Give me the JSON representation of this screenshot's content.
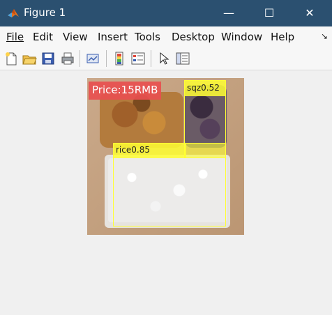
{
  "window": {
    "title": "Figure 1",
    "controls": {
      "minimize": "—",
      "maximize": "☐",
      "close": "✕"
    }
  },
  "menu": {
    "items": [
      {
        "label": "File",
        "mnemonic": "F"
      },
      {
        "label": "Edit",
        "mnemonic": "E"
      },
      {
        "label": "View",
        "mnemonic": "V"
      },
      {
        "label": "Insert",
        "mnemonic": "I"
      },
      {
        "label": "Tools",
        "mnemonic": "T"
      },
      {
        "label": "Desktop",
        "mnemonic": "D"
      },
      {
        "label": "Window",
        "mnemonic": "W"
      },
      {
        "label": "Help",
        "mnemonic": "H"
      }
    ],
    "overflow_arrow": "↘"
  },
  "toolbar": {
    "icons": [
      "new-figure-icon",
      "open-icon",
      "save-icon",
      "print-icon",
      "link-plot-icon",
      "insert-colorbar-icon",
      "insert-legend-icon",
      "select-arrow-icon",
      "property-inspector-icon"
    ]
  },
  "figure": {
    "price_label": "Price:15RMB",
    "detections": [
      {
        "label": "rice0.85"
      },
      {
        "label": "sqz0.52"
      }
    ],
    "colors": {
      "price_bg": "#e84f4f",
      "box_color": "#ffff33",
      "titlebar": "#2b5070"
    }
  }
}
